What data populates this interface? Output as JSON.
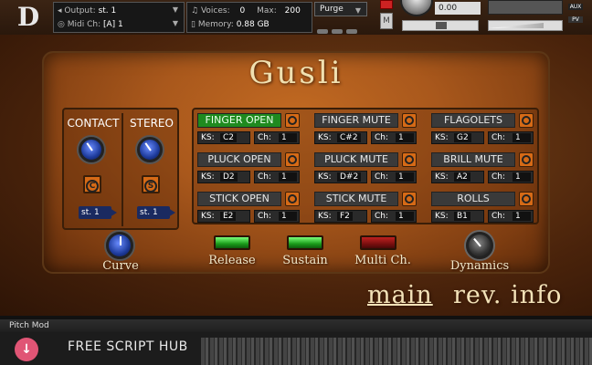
{
  "header": {
    "output_label": "Output:",
    "output_value": "st. 1",
    "midi_label": "Midi Ch:",
    "midi_value": "[A] 1",
    "voices_label": "Voices:",
    "voices_value": "0",
    "max_label": "Max:",
    "max_value": "200",
    "memory_label": "Memory:",
    "memory_value": "0.88 GB",
    "purge_label": "Purge",
    "m_label": "M",
    "tune_value": "0.00",
    "aux_label": "AUX",
    "pv_label": "PV"
  },
  "instrument": {
    "title": "Gusli",
    "contact_label": "CONTACT",
    "stereo_label": "STEREO",
    "contact_button": "C",
    "stereo_button": "S",
    "contact_output": "st. 1",
    "stereo_output": "st. 1"
  },
  "articulations": [
    {
      "name": "FINGER OPEN",
      "ks": "C2",
      "ch": "1",
      "active": true
    },
    {
      "name": "FINGER MUTE",
      "ks": "C#2",
      "ch": "1",
      "active": false
    },
    {
      "name": "FLAGOLETS",
      "ks": "G2",
      "ch": "1",
      "active": false
    },
    {
      "name": "PLUCK OPEN",
      "ks": "D2",
      "ch": "1",
      "active": false
    },
    {
      "name": "PLUCK MUTE",
      "ks": "D#2",
      "ch": "1",
      "active": false
    },
    {
      "name": "BRILL MUTE",
      "ks": "A2",
      "ch": "1",
      "active": false
    },
    {
      "name": "STICK OPEN",
      "ks": "E2",
      "ch": "1",
      "active": false
    },
    {
      "name": "STICK MUTE",
      "ks": "F2",
      "ch": "1",
      "active": false
    },
    {
      "name": "ROLLS",
      "ks": "B1",
      "ch": "1",
      "active": false
    }
  ],
  "field_labels": {
    "ks": "KS:",
    "ch": "Ch:"
  },
  "controls": {
    "curve": "Curve",
    "release": "Release",
    "sustain": "Sustain",
    "multi_ch": "Multi Ch.",
    "dynamics": "Dynamics"
  },
  "nav": {
    "main": "main",
    "rev_info": "rev. info"
  },
  "footer": {
    "pitch_mod": "Pitch Mod",
    "hub_text": "FREE SCRIPT HUB"
  },
  "colors": {
    "active_articulation": "#1f8a1f",
    "panel": "#a9581c",
    "led_on": "#1a9a1a",
    "led_off": "#7a0f0f"
  }
}
